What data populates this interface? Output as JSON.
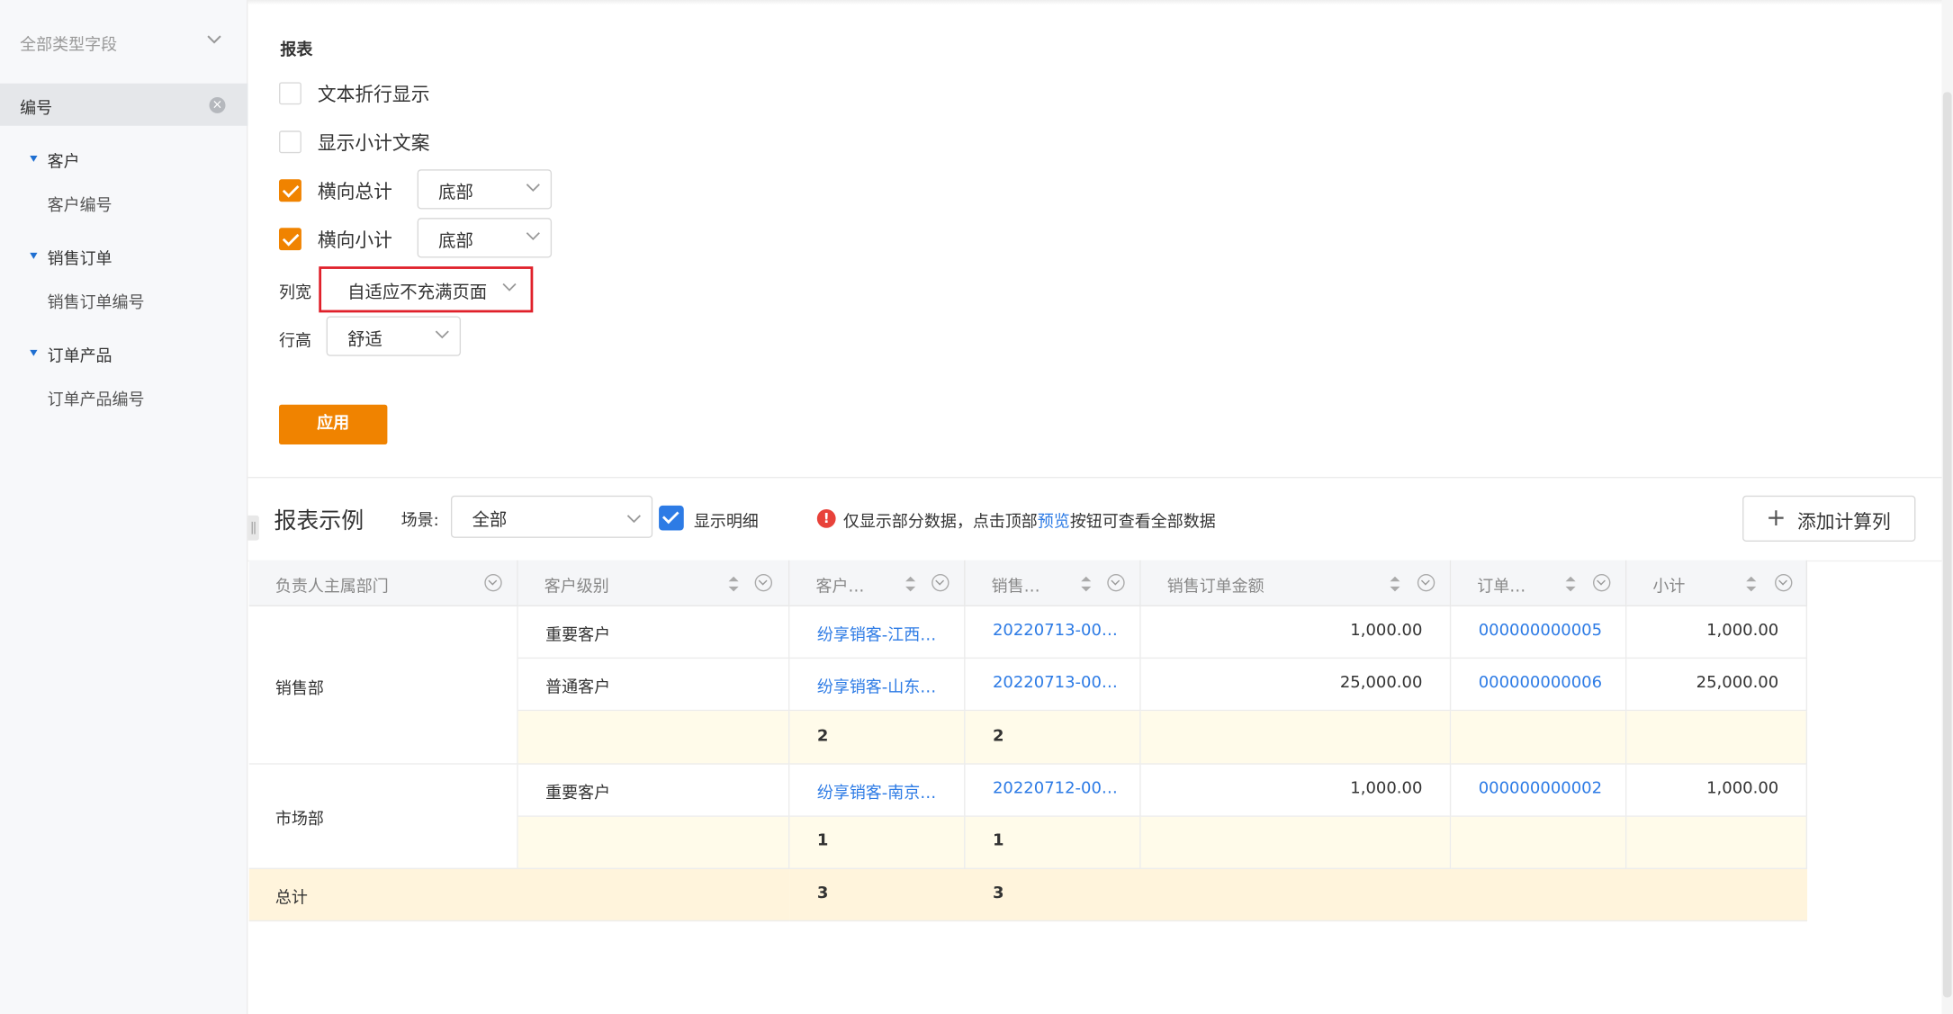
{
  "sidebar": {
    "type_filter": "全部类型字段",
    "selected": "编号",
    "groups": [
      {
        "label": "客户",
        "items": [
          "客户编号"
        ]
      },
      {
        "label": "销售订单",
        "items": [
          "销售订单编号"
        ]
      },
      {
        "label": "订单产品",
        "items": [
          "订单产品编号"
        ]
      }
    ]
  },
  "settings": {
    "title": "报表",
    "wrap_text": {
      "label": "文本折行显示",
      "checked": false
    },
    "show_subtotal_text": {
      "label": "显示小计文案",
      "checked": false
    },
    "h_total": {
      "label": "横向总计",
      "checked": true,
      "position": "底部"
    },
    "h_subtotal": {
      "label": "横向小计",
      "checked": true,
      "position": "底部"
    },
    "col_width": {
      "label": "列宽",
      "value": "自适应不充满页面"
    },
    "row_height": {
      "label": "行高",
      "value": "舒适"
    },
    "apply": "应用"
  },
  "example": {
    "title": "报表示例",
    "scene_label": "场景:",
    "scene_value": "全部",
    "show_detail": "显示明细",
    "notice_before": "仅显示部分数据，点击顶部",
    "notice_link": "预览",
    "notice_after": "按钮可查看全部数据",
    "add_calc": "添加计算列"
  },
  "table": {
    "columns": [
      "负责人主属部门",
      "客户级别",
      "客户…",
      "销售…",
      "销售订单金额",
      "订单…",
      "小计"
    ],
    "groups": [
      {
        "dept": "销售部",
        "rows": [
          {
            "level": "重要客户",
            "customer": "纷享销客-江西…",
            "order": "20220713-00…",
            "amount": "1,000.00",
            "product": "000000000005",
            "subtotal": "1,000.00"
          },
          {
            "level": "普通客户",
            "customer": "纷享销客-山东…",
            "order": "20220713-00…",
            "amount": "25,000.00",
            "product": "000000000006",
            "subtotal": "25,000.00"
          }
        ],
        "sub_customer": "2",
        "sub_order": "2"
      },
      {
        "dept": "市场部",
        "rows": [
          {
            "level": "重要客户",
            "customer": "纷享销客-南京…",
            "order": "20220712-00…",
            "amount": "1,000.00",
            "product": "000000000002",
            "subtotal": "1,000.00"
          }
        ],
        "sub_customer": "1",
        "sub_order": "1"
      }
    ],
    "total_label": "总计",
    "total_customer": "3",
    "total_order": "3"
  },
  "colors": {
    "accent": "#f08300",
    "link": "#2d7be5",
    "highlight_border": "#e0202a"
  }
}
